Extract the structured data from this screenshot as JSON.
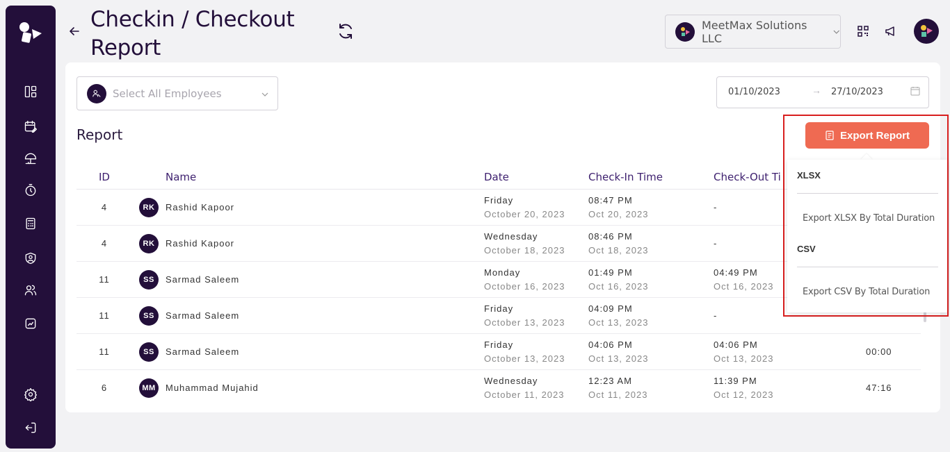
{
  "header": {
    "title": "Checkin / Checkout Report",
    "organization": "MeetMax Solutions LLC"
  },
  "filters": {
    "employee_placeholder": "Select All Employees",
    "date_start": "01/10/2023",
    "date_end": "27/10/2023",
    "date_separator": "→"
  },
  "report": {
    "label": "Report",
    "columns": [
      "ID",
      "Name",
      "Date",
      "Check-In Time",
      "Check-Out Ti"
    ],
    "rows": [
      {
        "id": "4",
        "initials": "RK",
        "name": "Rashid Kapoor",
        "day": "Friday",
        "date": "October 20, 2023",
        "in_time": "08:47 PM",
        "in_date": "Oct 20, 2023",
        "out": "-",
        "duration": ""
      },
      {
        "id": "4",
        "initials": "RK",
        "name": "Rashid Kapoor",
        "day": "Wednesday",
        "date": "October 18, 2023",
        "in_time": "08:46 PM",
        "in_date": "Oct 18, 2023",
        "out": "-",
        "duration": ""
      },
      {
        "id": "11",
        "initials": "SS",
        "name": "Sarmad Saleem",
        "day": "Monday",
        "date": "October 16, 2023",
        "in_time": "01:49 PM",
        "in_date": "Oct 16, 2023",
        "out_time": "04:49 PM",
        "out_date": "Oct 16, 2023",
        "duration": ""
      },
      {
        "id": "11",
        "initials": "SS",
        "name": "Sarmad Saleem",
        "day": "Friday",
        "date": "October 13, 2023",
        "in_time": "04:09 PM",
        "in_date": "Oct 13, 2023",
        "out": "-",
        "duration": ""
      },
      {
        "id": "11",
        "initials": "SS",
        "name": "Sarmad Saleem",
        "day": "Friday",
        "date": "October 13, 2023",
        "in_time": "04:06 PM",
        "in_date": "Oct 13, 2023",
        "out_time": "04:06 PM",
        "out_date": "Oct 13, 2023",
        "duration": "00:00"
      },
      {
        "id": "6",
        "initials": "MM",
        "name": "Muhammad Mujahid",
        "day": "Wednesday",
        "date": "October 11, 2023",
        "in_time": "12:23 AM",
        "in_date": "Oct 11, 2023",
        "out_time": "11:39 PM",
        "out_date": "Oct 12, 2023",
        "duration": "47:16"
      }
    ]
  },
  "export": {
    "button_label": "Export Report",
    "xlsx_heading": "XLSX",
    "xlsx_item": "Export XLSX By Total Duration",
    "csv_heading": "CSV",
    "csv_item": "Export CSV By Total Duration"
  },
  "colors": {
    "sidebar": "#230f3a",
    "accent": "#ef6a52",
    "highlight": "#d81e1e"
  }
}
